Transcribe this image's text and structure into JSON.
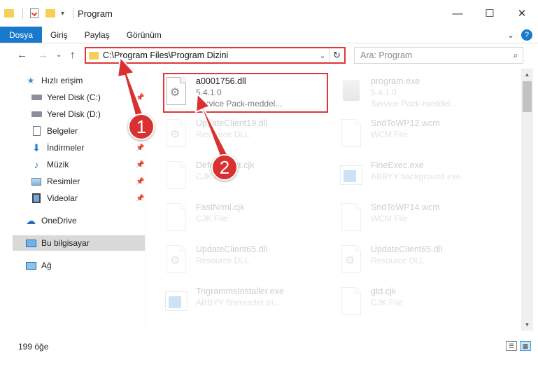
{
  "window": {
    "title": "Program",
    "minimize": "—",
    "maximize": "☐",
    "close": "✕"
  },
  "ribbon": {
    "tabs": [
      "Dosya",
      "Giriş",
      "Paylaş",
      "Görünüm"
    ],
    "collapse": "⌄",
    "help": "?"
  },
  "address": {
    "path": "C:\\Program Files\\Program Dizini",
    "search_placeholder": "Ara: Program"
  },
  "nav": {
    "quick_access": "Hızlı erişim",
    "items": [
      {
        "label": "Yerel Disk (C:)",
        "icon": "drive-icon"
      },
      {
        "label": "Yerel Disk (D:)",
        "icon": "drive-icon"
      },
      {
        "label": "Belgeler",
        "icon": "documents-icon"
      },
      {
        "label": "İndirmeler",
        "icon": "download-icon"
      },
      {
        "label": "Müzik",
        "icon": "music-icon"
      },
      {
        "label": "Resimler",
        "icon": "pictures-icon"
      },
      {
        "label": "Videolar",
        "icon": "videos-icon"
      }
    ],
    "onedrive": "OneDrive",
    "this_pc": "Bu bilgisayar",
    "network": "Ağ"
  },
  "files": [
    {
      "name": "a0001756.dll",
      "line2": "5.4.1.0",
      "line3": "Service Pack-meddel...",
      "icon": "dll",
      "highlighted": true
    },
    {
      "name": "program.exe",
      "line2": "5.4.1.0",
      "line3": "Service Pack-meddel...",
      "icon": "exe",
      "highlighted": false
    },
    {
      "name": "UpdateClient19.dll",
      "line2": "Resource DLL",
      "line3": "",
      "icon": "dll",
      "highlighted": false
    },
    {
      "name": "SndToWP12.wcm",
      "line2": "WCM File",
      "line3": "",
      "icon": "doc",
      "highlighted": false
    },
    {
      "name": "DefaultFont.cjk",
      "line2": "CJK File",
      "line3": "",
      "icon": "doc",
      "highlighted": false
    },
    {
      "name": "FineExec.exe",
      "line2": "ABBYY background exe...",
      "line3": "",
      "icon": "app",
      "highlighted": false
    },
    {
      "name": "FastNrml.cjk",
      "line2": "CJK File",
      "line3": "",
      "icon": "doc",
      "highlighted": false
    },
    {
      "name": "SndToWP14.wcm",
      "line2": "WCM File",
      "line3": "",
      "icon": "doc",
      "highlighted": false
    },
    {
      "name": "UpdateClient65.dll",
      "line2": "Resource DLL",
      "line3": "",
      "icon": "dll",
      "highlighted": false
    },
    {
      "name": "UpdateClient65.dll",
      "line2": "Resource DLL",
      "line3": "",
      "icon": "dll",
      "highlighted": false
    },
    {
      "name": "TrigrammsInstaller.exe",
      "line2": "ABBYY finereader tri...",
      "line3": "",
      "icon": "app",
      "highlighted": false
    },
    {
      "name": "gtd.cjk",
      "line2": "CJK File",
      "line3": "",
      "icon": "doc",
      "highlighted": false
    }
  ],
  "status": {
    "count": "199 öğe"
  },
  "callouts": [
    "1",
    "2"
  ],
  "colors": {
    "accent": "#1979ca",
    "annotation": "#e03636",
    "folder": "#f7cf55"
  }
}
